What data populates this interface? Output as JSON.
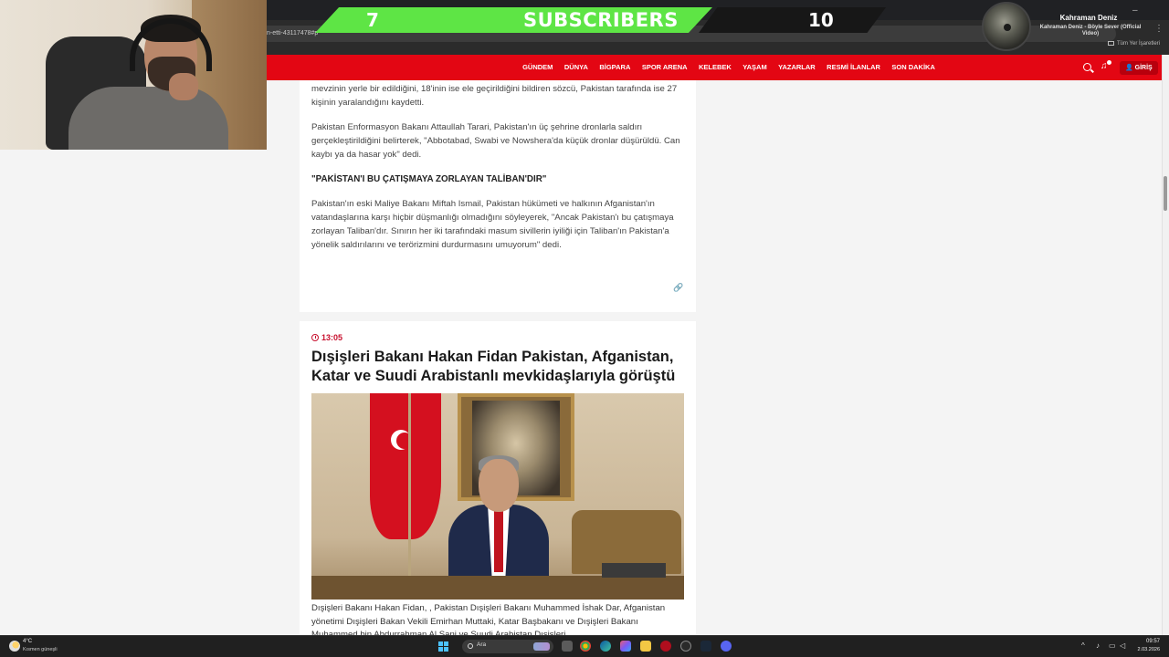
{
  "browser": {
    "url_fragment": "n-etti-43117478#p",
    "bookmarks_label": "Tüm Yer İşaretleri"
  },
  "overlay": {
    "subscribers_current": "7",
    "subscribers_label": "SUBSCRIBERS",
    "subscribers_goal": "10",
    "music_artist": "Kahraman Deniz",
    "music_track": "Kahraman Deniz - Böyle Sever (Official Video)"
  },
  "site": {
    "nav_items": [
      "GÜNDEM",
      "DÜNYA",
      "BİGPARA",
      "SPOR ARENA",
      "KELEBEK",
      "YAŞAM",
      "YAZARLAR",
      "RESMİ İLANLAR",
      "SON DAKİKA"
    ],
    "login_label": "GİRİŞ",
    "brand_color": "#e30613"
  },
  "article1": {
    "para1": "mevzinin yerle bir edildiğini, 18'inin ise ele geçirildiğini bildiren sözcü, Pakistan tarafında ise 27 kişinin yaralandığını kaydetti.",
    "para2": "Pakistan Enformasyon Bakanı Attaullah Tarari, Pakistan'ın üç şehrine dronlarla saldırı gerçekleştirildiğini belirterek, \"Abbotabad, Swabi ve Nowshera'da küçük dronlar düşürüldü. Can kaybı ya da hasar yok\" dedi.",
    "subhead": "\"PAKİSTAN'I BU ÇATIŞMAYA ZORLAYAN TALİBAN'DIR\"",
    "para3": "Pakistan'ın eski Maliye Bakanı Miftah Ismail, Pakistan hükümeti ve halkının Afganistan'ın vatandaşlarına karşı hiçbir düşmanlığı olmadığını söyleyerek, \"Ancak Pakistan'ı bu çatışmaya zorlayan Taliban'dır. Sınırın her iki tarafındaki masum sivillerin iyiliği için Taliban'ın Pakistan'a yönelik saldırılarını ve terörizmini durdurmasını umuyorum\" dedi."
  },
  "article2": {
    "time": "13:05",
    "headline": "Dışişleri Bakanı Hakan Fidan Pakistan, Afganistan, Katar ve Suudi Arabistanlı mevkidaşlarıyla görüştü",
    "caption": "Dışişleri Bakanı Hakan Fidan, , Pakistan Dışişleri Bakanı Muhammed İshak Dar, Afganistan yönetimi Dışişleri Bakan Vekili Emirhan Muttaki, Katar Başbakanı ve Dışişleri Bakanı Muhammed bin Abdurrahman Al Sani ve Suudi Arabistan Dışişleri"
  },
  "taskbar": {
    "weather_temp": "4°C",
    "weather_desc": "Kısmen güneşli",
    "search_placeholder": "Ara",
    "time": "09:57",
    "date": "2.03.2026"
  }
}
